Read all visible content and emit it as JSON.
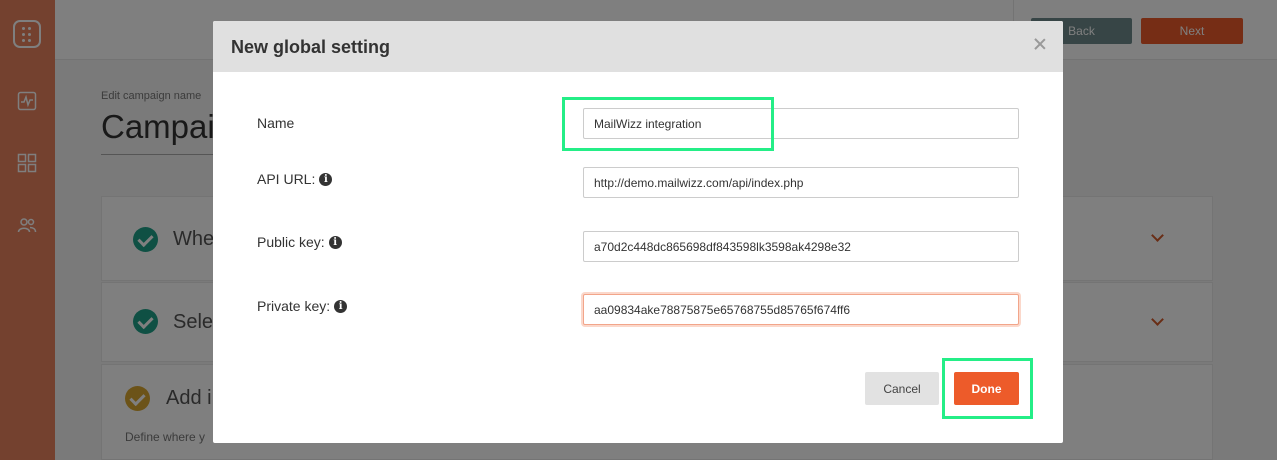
{
  "background": {
    "sidebar": {
      "icons": [
        "grid-dots-icon",
        "chart-icon",
        "dashboard-icon",
        "users-icon"
      ],
      "color": "#e8835f"
    },
    "topbar": {
      "back_label": "Back",
      "next_label": "Next"
    },
    "campaign": {
      "label": "Edit campaign name",
      "name": "Campai"
    },
    "steps": [
      {
        "title": "Whe",
        "status": "complete"
      },
      {
        "title": "Sele",
        "status": "complete"
      },
      {
        "title": "Add i",
        "status": "in-progress",
        "description": "Define where y"
      }
    ]
  },
  "modal": {
    "title": "New global setting",
    "fields": [
      {
        "label": "Name",
        "value": "MailWizz integration",
        "info": false
      },
      {
        "label": "API URL:",
        "value": "http://demo.mailwizz.com/api/index.php",
        "info": true
      },
      {
        "label": "Public key:",
        "value": "a70d2c448dc865698df843598lk3598ak4298e32",
        "info": true
      },
      {
        "label": "Private key:",
        "value": "aa09834ake78875875e65768755d85765f674ff6",
        "info": true
      }
    ],
    "cancel_label": "Cancel",
    "done_label": "Done"
  },
  "colors": {
    "accent": "#ed5b2a",
    "success": "#1fa088",
    "highlight": "#24ee87"
  }
}
